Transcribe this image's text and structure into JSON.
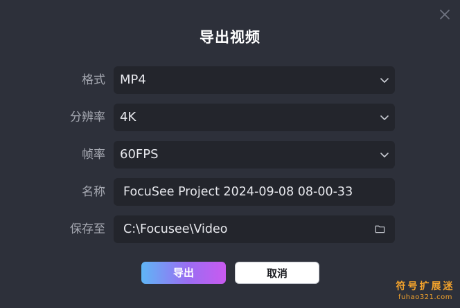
{
  "dialog": {
    "title": "导出视频",
    "close_icon": "close-icon"
  },
  "fields": {
    "format": {
      "label": "格式",
      "value": "MP4",
      "icon": "chevron-down-icon"
    },
    "resolution": {
      "label": "分辨率",
      "value": "4K",
      "icon": "chevron-down-icon"
    },
    "framerate": {
      "label": "帧率",
      "value": "60FPS",
      "icon": "chevron-down-icon"
    },
    "name": {
      "label": "名称",
      "value": "FocuSee Project 2024-09-08 08-00-33"
    },
    "save_path": {
      "label": "保存至",
      "value": "C:\\Focusee\\Video",
      "icon": "folder-icon"
    }
  },
  "buttons": {
    "export": "导出",
    "cancel": "取消"
  },
  "colors": {
    "background": "#2d303a",
    "field_bg": "#23252c",
    "gradient_start": "#5fb6f6",
    "gradient_end": "#c95af0",
    "watermark": "#f2a22c"
  },
  "watermark": {
    "main": "符号扩展迷",
    "sub": "fuhao321.com"
  }
}
